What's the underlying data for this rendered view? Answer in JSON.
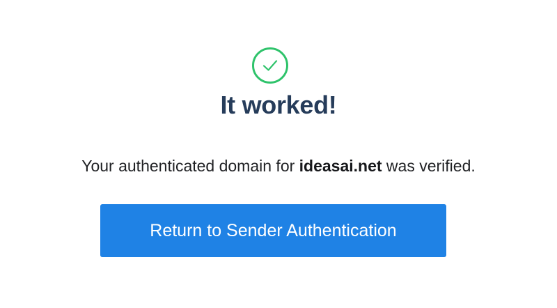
{
  "status": {
    "icon": "check-circle-icon",
    "icon_color": "#2fc36b",
    "title": "It worked!"
  },
  "message": {
    "prefix": "Your authenticated domain for ",
    "domain": "ideasai.net",
    "suffix": " was verified."
  },
  "actions": {
    "return_label": "Return to Sender Authentication",
    "button_color": "#1f82e5"
  },
  "colors": {
    "title": "#263c5a",
    "text": "#1f2023",
    "background": "#ffffff"
  }
}
